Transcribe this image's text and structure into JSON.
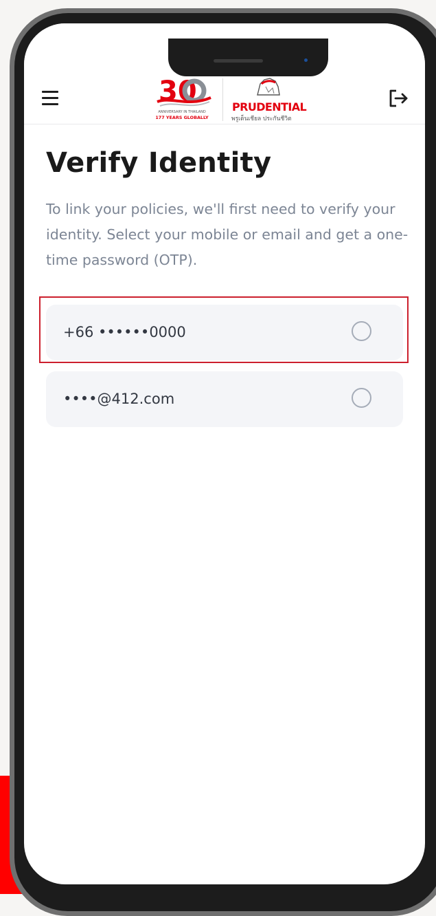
{
  "header": {
    "menu_icon": "hamburger-icon",
    "logout_icon": "logout-icon",
    "anniversary_logo": {
      "numeral": "30",
      "line1": "ANNIVERSARY IN THAILAND",
      "line2": "177 YEARS GLOBALLY"
    },
    "brand_logo": {
      "name": "PRUDENTIAL",
      "thai": "พรูเด็นเชียล ประกันชีวิต"
    }
  },
  "page": {
    "title": "Verify Identity",
    "description": "To link your policies, we'll first need to verify your identity. Select your mobile or email and get a one-time password (OTP)."
  },
  "options": [
    {
      "label": "+66 ••••••0000",
      "selected": false
    },
    {
      "label": "••••@412.com",
      "selected": false
    }
  ],
  "colors": {
    "brand_red": "#e3000f",
    "highlight_border": "#cc1f2d",
    "option_bg": "#f4f5f8",
    "description_text": "#7c8594"
  }
}
